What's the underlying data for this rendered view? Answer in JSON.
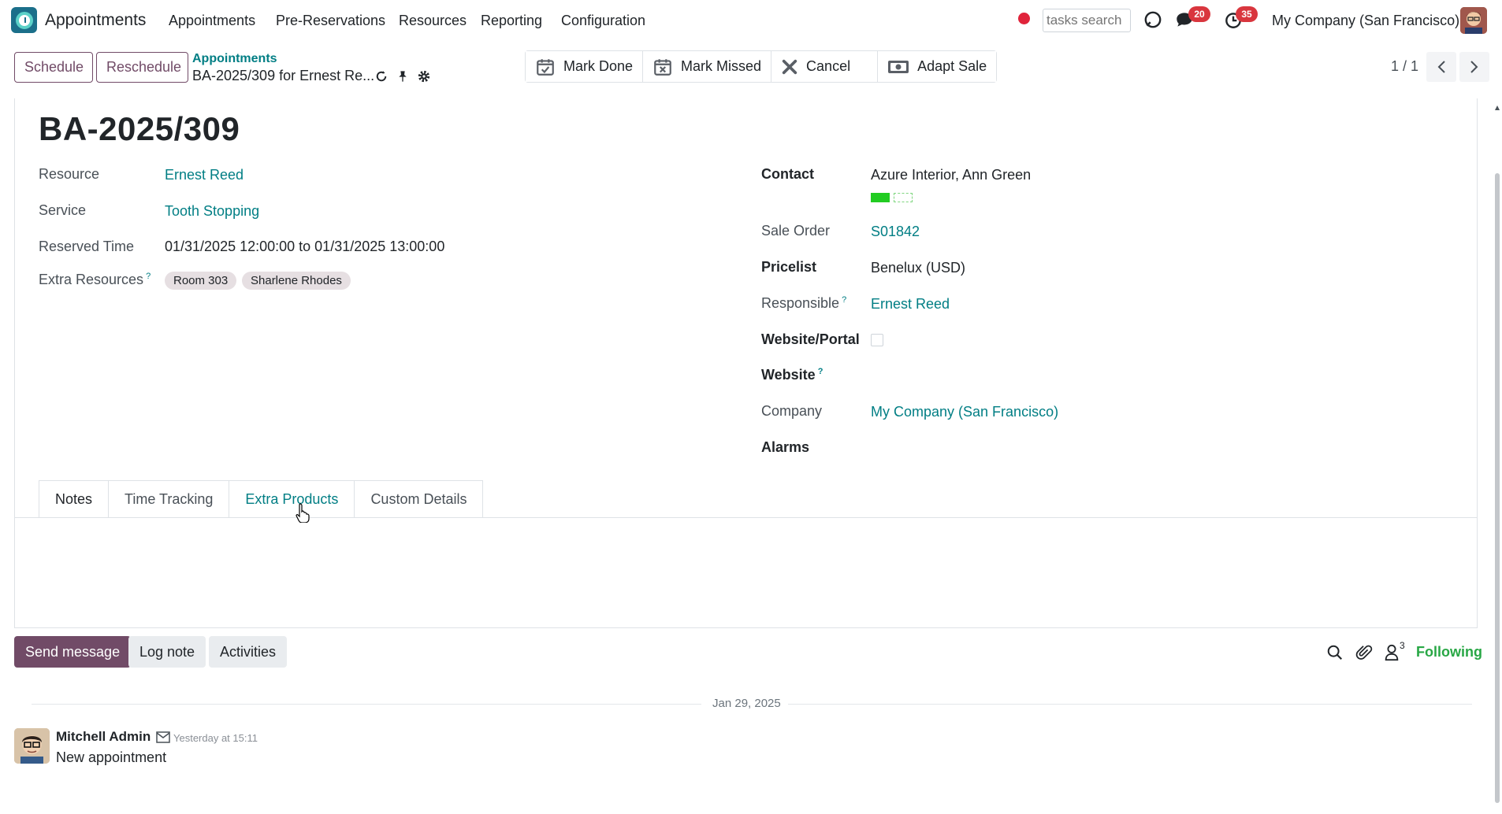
{
  "app": {
    "name": "Appointments",
    "menu": [
      "Appointments",
      "Pre-Reservations",
      "Resources",
      "Reporting",
      "Configuration"
    ],
    "search_placeholder": "tasks search",
    "messages_badge": "20",
    "activities_badge": "35",
    "company": "My Company (San Francisco)"
  },
  "control": {
    "schedule_label": "Schedule",
    "reschedule_label": "Reschedule",
    "breadcrumb_parent": "Appointments",
    "breadcrumb_current": "BA-2025/309 for Ernest Re...",
    "actions": {
      "mark_done": "Mark Done",
      "mark_missed": "Mark Missed",
      "cancel": "Cancel",
      "adapt_sale": "Adapt Sale"
    },
    "pager": "1 / 1"
  },
  "record": {
    "title": "BA-2025/309",
    "left": {
      "resource_label": "Resource",
      "resource_value": "Ernest Reed",
      "service_label": "Service",
      "service_value": "Tooth Stopping",
      "reserved_label": "Reserved Time",
      "reserved_value": "01/31/2025 12:00:00 to 01/31/2025 13:00:00",
      "extra_resources_label": "Extra Resources",
      "extra_resources_sup": "?",
      "extra_resources": [
        "Room 303",
        "Sharlene Rhodes"
      ]
    },
    "right": {
      "contact_label": "Contact",
      "contact_value": "Azure Interior, Ann Green",
      "contact_color": "#22cc22",
      "sale_order_label": "Sale Order",
      "sale_order_value": "S01842",
      "pricelist_label": "Pricelist",
      "pricelist_value": "Benelux (USD)",
      "responsible_label": "Responsible",
      "responsible_sup": "?",
      "responsible_value": "Ernest Reed",
      "website_portal_label": "Website/Portal",
      "website_portal_checked": false,
      "website_label": "Website",
      "website_sup": "?",
      "company_label": "Company",
      "company_value": "My Company (San Francisco)",
      "alarms_label": "Alarms"
    }
  },
  "tabs": [
    "Notes",
    "Time Tracking",
    "Extra Products",
    "Custom Details"
  ],
  "chatter": {
    "send_message": "Send message",
    "log_note": "Log note",
    "activities": "Activities",
    "followers_count": "3",
    "following_label": "Following",
    "date_separator": "Jan 29, 2025",
    "message": {
      "author": "Mitchell Admin",
      "time": "Yesterday at 15:11",
      "body": "New appointment"
    }
  },
  "colors": {
    "brand": "#714b67",
    "link": "#017e84",
    "badge": "#d9363e",
    "following": "#28a745"
  }
}
